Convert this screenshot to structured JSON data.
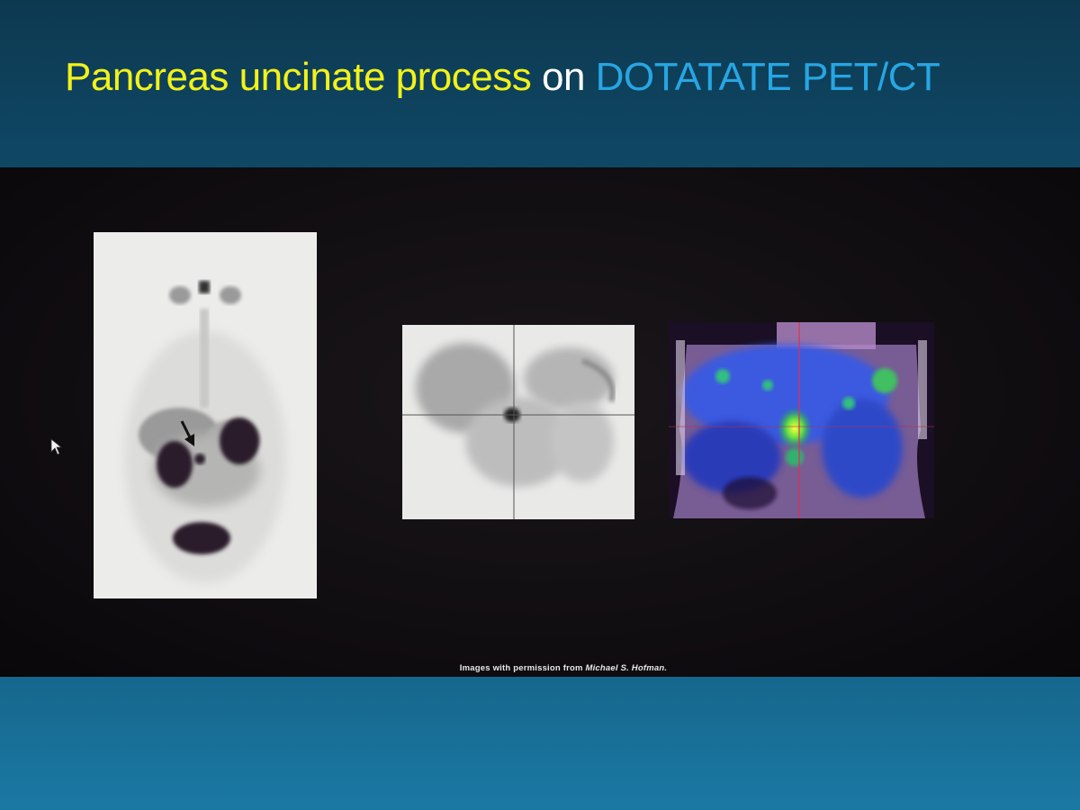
{
  "slide": {
    "title_part1": "Pancreas uncinate process",
    "title_part2": " on ",
    "title_part3": "DOTATATE PET/CT",
    "caption_prefix": "Images with permission from ",
    "caption_name": "Michael S. Hofman."
  },
  "colors": {
    "title_yellow": "#f2f21a",
    "title_white": "#ffffff",
    "title_blue": "#27a6e3"
  }
}
